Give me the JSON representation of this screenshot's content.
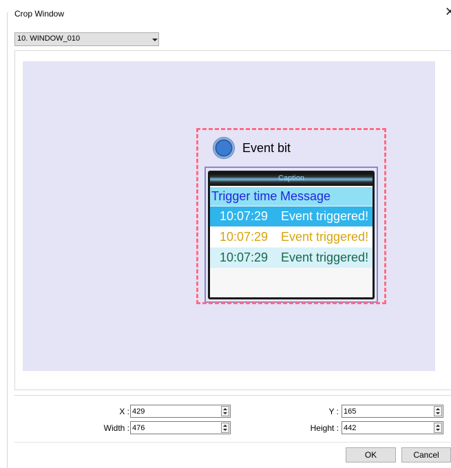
{
  "window": {
    "title": "Crop Window",
    "close_glyph": "✕"
  },
  "window_select": {
    "selected": "10. WINDOW_010"
  },
  "preview": {
    "event_bit_label": "Event bit",
    "message_display": {
      "caption": "Caption",
      "header": {
        "trigger_time": "Trigger time",
        "message": "Message"
      },
      "rows": [
        {
          "time": "10:07:29",
          "message": "Event triggered!"
        },
        {
          "time": "10:07:29",
          "message": "Event triggered!"
        },
        {
          "time": "10:07:29",
          "message": "Event triggered!"
        }
      ]
    }
  },
  "fields": {
    "x": {
      "label": "X :",
      "value": "429"
    },
    "y": {
      "label": "Y :",
      "value": "165"
    },
    "width": {
      "label": "Width :",
      "value": "476"
    },
    "height": {
      "label": "Height :",
      "value": "442"
    }
  },
  "buttons": {
    "ok": "OK",
    "cancel": "Cancel"
  },
  "colors": {
    "canvas_bg": "#e4e4f6",
    "crop_border": "#ff6b86",
    "row1_bg": "#2fb4ec",
    "row2_text": "#d6a40e",
    "row3_text": "#1a6650",
    "header_text": "#2323e0"
  },
  "icons": {
    "close": "close-icon",
    "dropdown": "chevron-down-icon",
    "lamp": "round-lamp-icon"
  }
}
